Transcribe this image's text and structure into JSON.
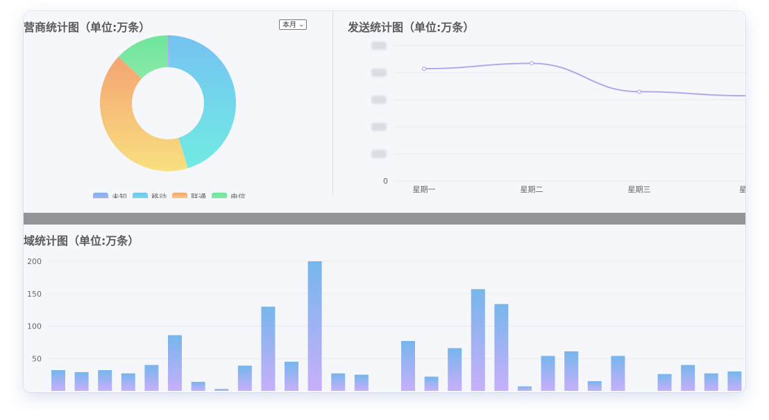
{
  "operator_panel": {
    "title": "营商统计图（单位:万条）",
    "filter": {
      "selected": "本月"
    }
  },
  "send_panel": {
    "title": "发送统计图（单位:万条）"
  },
  "region_panel": {
    "title": "域统计图（单位:万条）"
  },
  "chart_data": [
    {
      "type": "pie",
      "title": "营商统计图（单位:万条）",
      "donut": true,
      "slices": [
        {
          "name": "未知",
          "value": 0.5,
          "color_from": "#7eb6ec",
          "color_to": "#c3aaf6"
        },
        {
          "name": "移动",
          "value": 45,
          "color_from": "#74c2f2",
          "color_to": "#72ebe3"
        },
        {
          "name": "联通",
          "value": 42,
          "color_from": "#f4a473",
          "color_to": "#f8e07f"
        },
        {
          "name": "电信",
          "value": 13,
          "color_from": "#6fe59c",
          "color_to": "#89eaa7"
        }
      ],
      "legend": "bottom"
    },
    {
      "type": "line",
      "title": "发送统计图（单位:万条）",
      "categories": [
        "星期一",
        "星期二",
        "星期三",
        "星期四"
      ],
      "category_labels_shown": [
        "星期一",
        "星期二",
        "星期三",
        "星期"
      ],
      "values": [
        83,
        87,
        66,
        63
      ],
      "ylim": [
        0,
        100
      ],
      "y_tick_shown": "0",
      "line_color": "#b3a6ef",
      "grid": true
    },
    {
      "type": "bar",
      "title": "域统计图（单位:万条）",
      "values": [
        32,
        29,
        32,
        27,
        40,
        86,
        14,
        3,
        39,
        130,
        45,
        200,
        27,
        25,
        0,
        77,
        22,
        66,
        157,
        134,
        7,
        54,
        61,
        15,
        54,
        0,
        26,
        40,
        27,
        30
      ],
      "ylim": [
        0,
        200
      ],
      "yticks": [
        "200",
        "150",
        "100",
        "50"
      ],
      "bar_color_top": "#76b6ec",
      "bar_color_bottom": "#c8affa",
      "grid": true
    }
  ]
}
